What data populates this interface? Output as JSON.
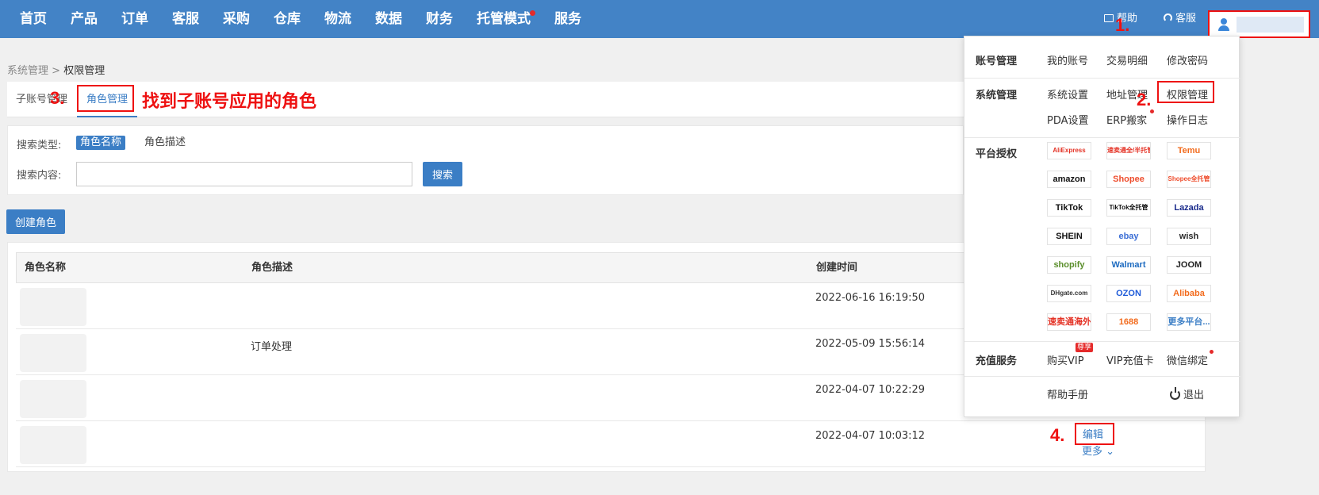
{
  "nav": {
    "items": [
      "首页",
      "产品",
      "订单",
      "客服",
      "采购",
      "仓库",
      "物流",
      "数据",
      "财务",
      "托管模式",
      "服务"
    ],
    "help": "帮助",
    "customer_service": "客服"
  },
  "breadcrumb": {
    "parent": "系统管理",
    "separator": ">",
    "current": "权限管理"
  },
  "tabs": {
    "sub_account": "子账号管理",
    "role": "角色管理"
  },
  "search": {
    "type_label": "搜索类型:",
    "type_selected": "角色名称",
    "type_other": "角色描述",
    "content_label": "搜索内容:",
    "input_value": "",
    "button": "搜索"
  },
  "create_button": "创建角色",
  "table": {
    "headers": [
      "角色名称",
      "角色描述",
      "创建时间"
    ],
    "rows": [
      {
        "description": "",
        "created": "2022-06-16 16:19:50"
      },
      {
        "description": "订单处理",
        "created": "2022-05-09 15:56:14"
      },
      {
        "description": "",
        "created": "2022-04-07 10:22:29"
      },
      {
        "description": "",
        "created": "2022-04-07 10:03:12"
      }
    ],
    "edit": "编辑",
    "more": "更多"
  },
  "dropdown": {
    "account": {
      "title": "账号管理",
      "links": [
        "我的账号",
        "交易明细",
        "修改密码"
      ]
    },
    "system": {
      "title": "系统管理",
      "links": [
        "系统设置",
        "地址管理",
        "权限管理",
        "PDA设置",
        "ERP搬家",
        "操作日志"
      ]
    },
    "platform": {
      "title": "平台授权",
      "logos": [
        {
          "text": "AliExpress",
          "color": "#e43225"
        },
        {
          "text": "速卖通全/半托管",
          "color": "#e43225"
        },
        {
          "text": "Temu",
          "color": "#f26b1d"
        },
        {
          "text": "amazon",
          "color": "#111111"
        },
        {
          "text": "Shopee",
          "color": "#ee4d2d"
        },
        {
          "text": "Shopee全托管",
          "color": "#ee4d2d"
        },
        {
          "text": "TikTok",
          "color": "#111111"
        },
        {
          "text": "TikTok全托管",
          "color": "#111111"
        },
        {
          "text": "Lazada",
          "color": "#1a2b8c"
        },
        {
          "text": "SHEIN",
          "color": "#111111"
        },
        {
          "text": "ebay",
          "color": "#3b6ed5"
        },
        {
          "text": "wish",
          "color": "#2b2b2b"
        },
        {
          "text": "shopify",
          "color": "#5a8e2a"
        },
        {
          "text": "Walmart",
          "color": "#1d6bc0"
        },
        {
          "text": "JOOM",
          "color": "#222222"
        },
        {
          "text": "DHgate.com",
          "color": "#333333"
        },
        {
          "text": "OZON",
          "color": "#1f5bd8"
        },
        {
          "text": "Alibaba",
          "color": "#f26b1d"
        },
        {
          "text": "速卖通海外托管",
          "color": "#e43225"
        },
        {
          "text": "1688",
          "color": "#f26b1d"
        },
        {
          "text": "更多平台...",
          "color": "#3b7ec5"
        }
      ]
    },
    "recharge": {
      "title": "充值服务",
      "links": [
        "购买VIP",
        "VIP充值卡",
        "微信绑定"
      ],
      "vip_tag": "尊享"
    },
    "help_manual": "帮助手册",
    "logout": "退出"
  },
  "annotations": {
    "step1": "1.",
    "step2": "2.",
    "step3": "3.",
    "step4": "4.",
    "find_role": "找到子账号应用的角色"
  },
  "colors": {
    "nav_bg": "#4383c6",
    "primary": "#3b7ec5",
    "highlight": "#ee1111"
  }
}
